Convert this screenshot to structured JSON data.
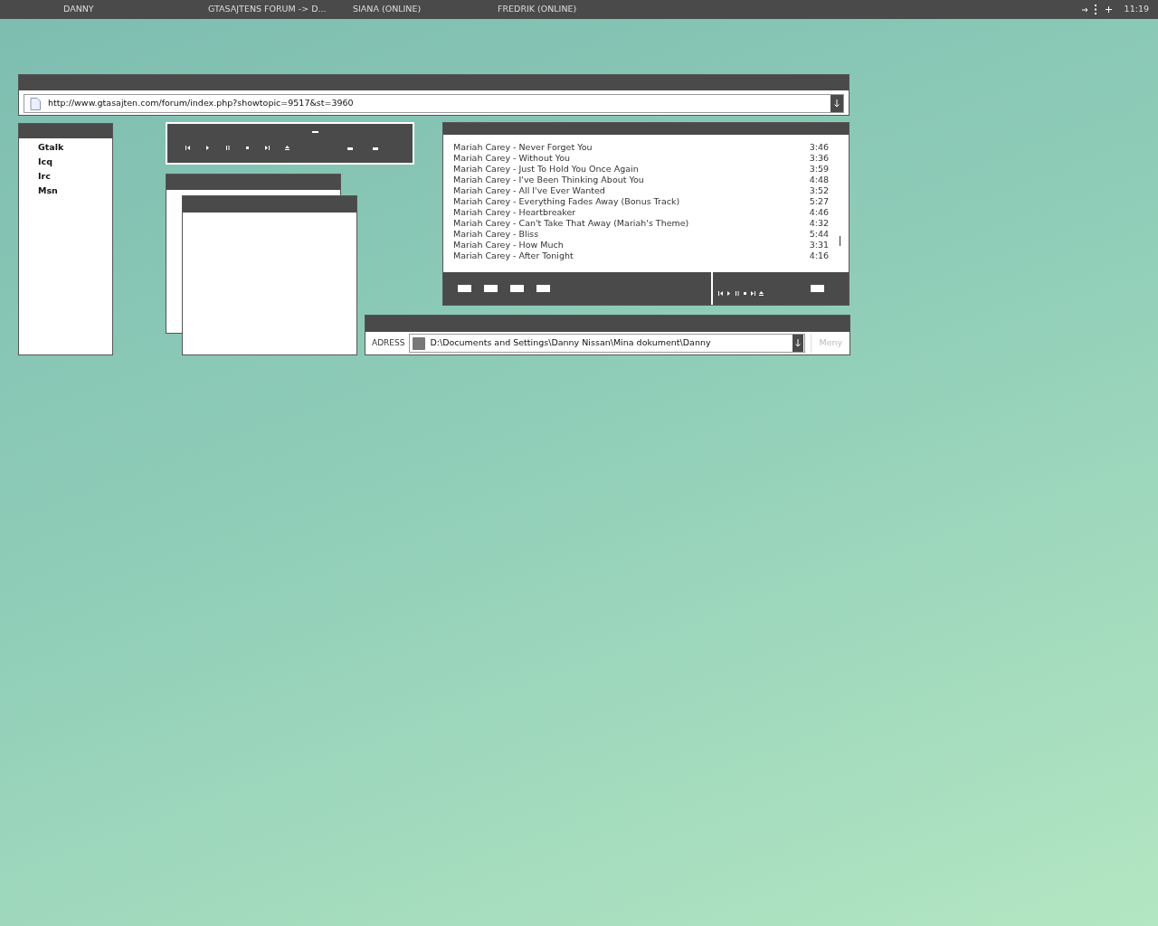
{
  "taskbar": {
    "items": [
      {
        "label": "DANNY"
      },
      {
        "label": "GTASAJTENS FORUM -> D..."
      },
      {
        "label": "SIANA (ONLINE)"
      },
      {
        "label": "FREDRIK (ONLINE)"
      }
    ],
    "clock": "11:19"
  },
  "browser": {
    "url": "http://www.gtasajten.com/forum/index.php?showtopic=9517&st=3960"
  },
  "contacts": {
    "items": [
      {
        "label": "Gtalk"
      },
      {
        "label": "Icq"
      },
      {
        "label": "Irc"
      },
      {
        "label": "Msn"
      }
    ]
  },
  "playlist": {
    "tracks": [
      {
        "title": "Mariah Carey - Never Forget You",
        "duration": "3:46"
      },
      {
        "title": "Mariah Carey - Without You",
        "duration": "3:36"
      },
      {
        "title": "Mariah Carey - Just To Hold You Once Again",
        "duration": "3:59"
      },
      {
        "title": "Mariah Carey - I've Been Thinking About You",
        "duration": "4:48"
      },
      {
        "title": "Mariah Carey - All I've Ever Wanted",
        "duration": "3:52"
      },
      {
        "title": "Mariah Carey - Everything Fades Away (Bonus Track)",
        "duration": "5:27"
      },
      {
        "title": "Mariah Carey - Heartbreaker",
        "duration": "4:46"
      },
      {
        "title": "Mariah Carey - Can't Take That Away (Mariah's Theme)",
        "duration": "4:32"
      },
      {
        "title": "Mariah Carey - Bliss",
        "duration": "5:44"
      },
      {
        "title": "Mariah Carey - How Much",
        "duration": "3:31"
      },
      {
        "title": "Mariah Carey - After Tonight",
        "duration": "4:16"
      }
    ]
  },
  "explorer": {
    "address_label": "ADRESS",
    "path": "D:\\Documents and Settings\\Danny Nissan\\Mina dokument\\Danny",
    "menu_button": "Meny"
  }
}
